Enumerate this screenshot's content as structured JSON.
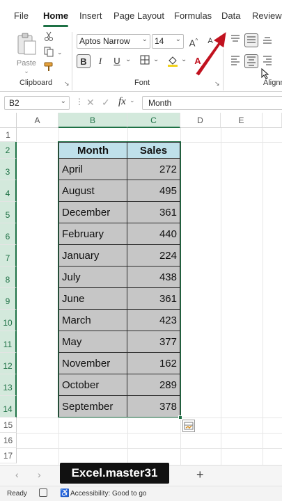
{
  "ribbon_tabs": [
    "File",
    "Home",
    "Insert",
    "Page Layout",
    "Formulas",
    "Data",
    "Review"
  ],
  "clipboard": {
    "paste_label": "Paste",
    "group_label": "Clipboard"
  },
  "font": {
    "name": "Aptos Narrow",
    "size": "14",
    "bold": "B",
    "italic": "I",
    "underline": "U",
    "group_label": "Font"
  },
  "alignment": {
    "group_label": "Alignm"
  },
  "formula_bar": {
    "name_box": "B2",
    "formula": "Month",
    "fx": "fx"
  },
  "columns": [
    "A",
    "B",
    "C",
    "D",
    "E"
  ],
  "rows": [
    "1",
    "2",
    "3",
    "4",
    "5",
    "6",
    "7",
    "8",
    "9",
    "10",
    "11",
    "12",
    "13",
    "14",
    "15",
    "16",
    "17"
  ],
  "table": {
    "headers": [
      "Month",
      "Sales"
    ],
    "rows": [
      [
        "April",
        "272"
      ],
      [
        "August",
        "495"
      ],
      [
        "December",
        "361"
      ],
      [
        "February",
        "440"
      ],
      [
        "January",
        "224"
      ],
      [
        "July",
        "438"
      ],
      [
        "June",
        "361"
      ],
      [
        "March",
        "423"
      ],
      [
        "May",
        "377"
      ],
      [
        "November",
        "162"
      ],
      [
        "October",
        "289"
      ],
      [
        "September",
        "378"
      ]
    ]
  },
  "sheet_tabs": {
    "add": "+"
  },
  "watermark": "Excel.master31",
  "status": {
    "ready": "Ready",
    "accessibility": "Accessibility: Good to go"
  },
  "colors": {
    "header_fill": "#bfe0ea",
    "data_fill": "#c6c6c6",
    "selection": "#1e7145",
    "arrow": "#c1121f"
  }
}
